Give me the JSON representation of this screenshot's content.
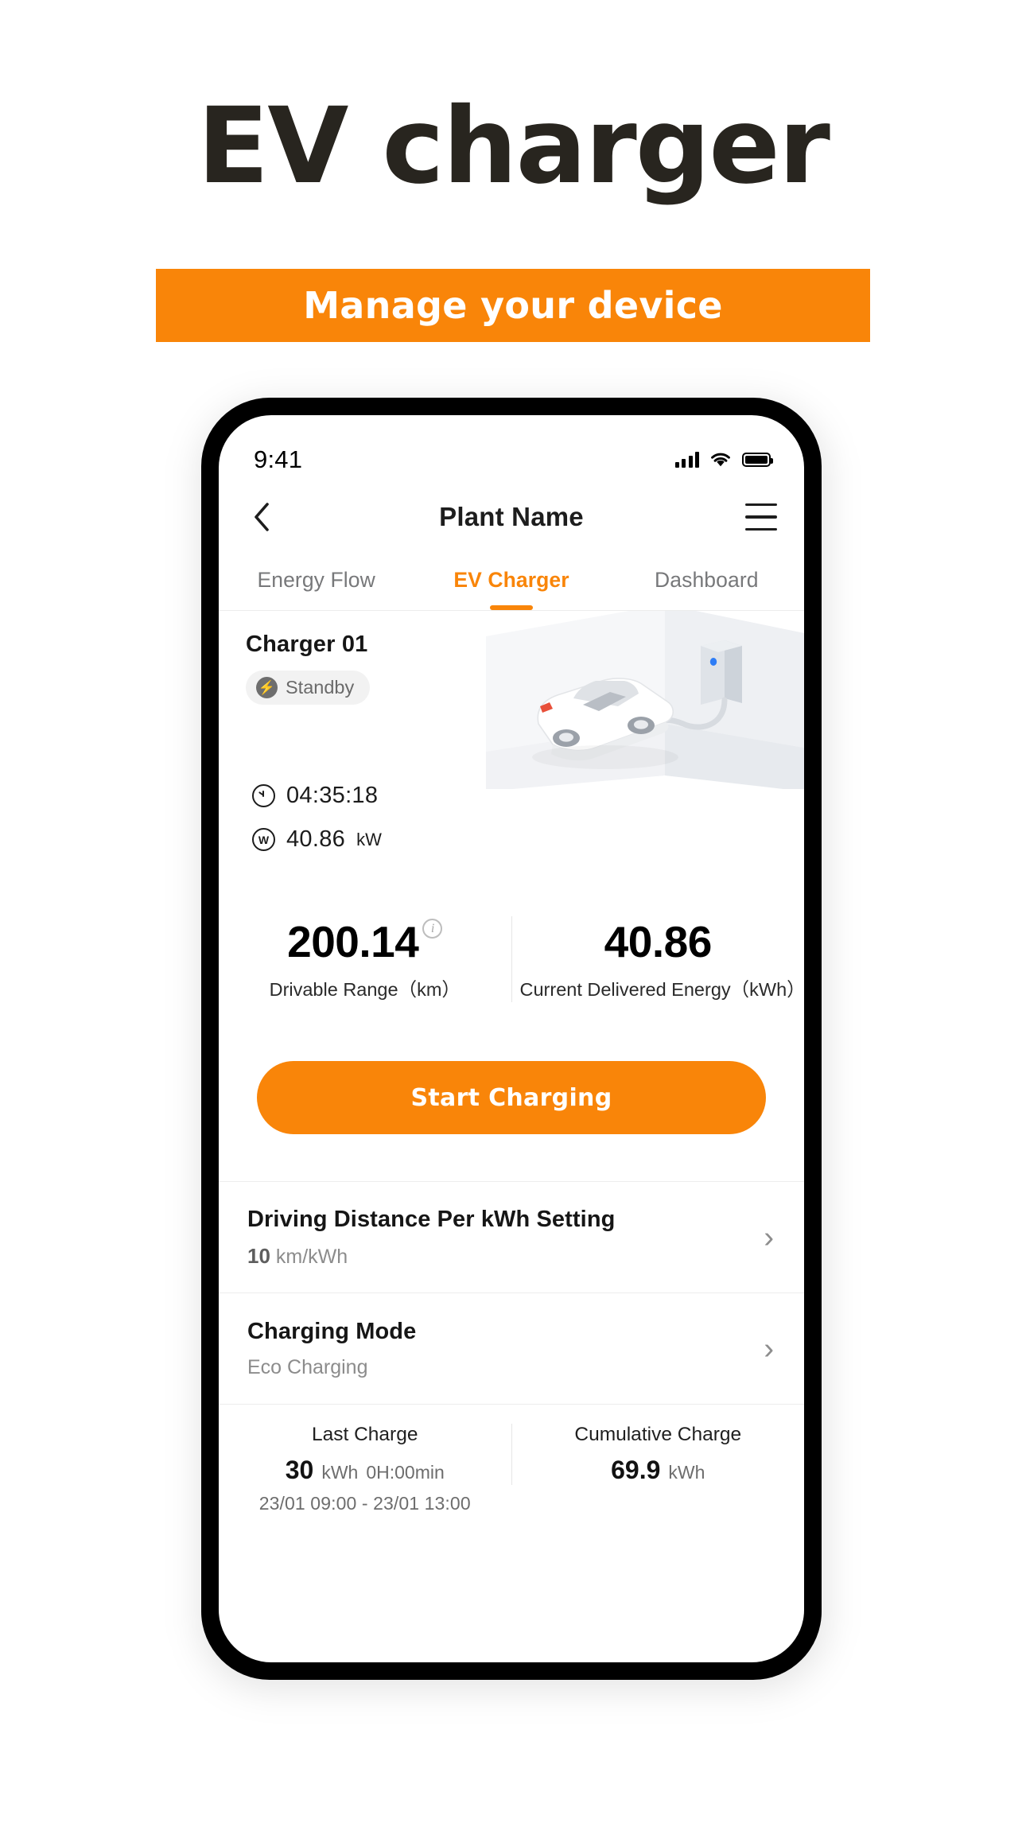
{
  "promo": {
    "title": "EV charger",
    "banner": "Manage your device"
  },
  "statusbar": {
    "time": "9:41",
    "signal_icon": "signal-bars-icon",
    "wifi_icon": "wifi-icon",
    "battery_icon": "battery-full-icon"
  },
  "navbar": {
    "back_icon": "chevron-left-icon",
    "title": "Plant Name",
    "menu_icon": "hamburger-menu-icon"
  },
  "tabs": [
    {
      "label": "Energy Flow",
      "active": false
    },
    {
      "label": "EV Charger",
      "active": true
    },
    {
      "label": "Dashboard",
      "active": false
    }
  ],
  "charger": {
    "name": "Charger 01",
    "status_badge": "Standby",
    "status_icon": "lightning-bolt-icon",
    "duration": "04:35:18",
    "duration_icon": "clock-icon",
    "power_value": "40.86",
    "power_unit": "kW",
    "power_icon": "watt-circle-icon"
  },
  "stats": [
    {
      "value": "200.14",
      "label": "Drivable Range（km）",
      "has_info": true,
      "info_icon": "info-circle-icon"
    },
    {
      "value": "40.86",
      "label": "Current Delivered Energy（kWh）",
      "has_info": false
    }
  ],
  "cta": {
    "label": "Start Charging"
  },
  "settings": [
    {
      "title": "Driving Distance Per kWh Setting",
      "value_number": "10",
      "value_unit": "km/kWh",
      "chevron_icon": "chevron-right-icon"
    },
    {
      "title": "Charging Mode",
      "value_text": "Eco Charging",
      "chevron_icon": "chevron-right-icon"
    }
  ],
  "summary": {
    "last_charge": {
      "title": "Last Charge",
      "amount": "30",
      "amount_unit": "kWh",
      "duration": "0H:00min",
      "range": "23/01 09:00  -  23/01 13:00"
    },
    "cumulative_charge": {
      "title": "Cumulative Charge",
      "amount": "69.9",
      "amount_unit": "kWh"
    }
  },
  "colors": {
    "accent": "#F98509",
    "title": "#28251f",
    "muted": "#8c8c8c"
  }
}
